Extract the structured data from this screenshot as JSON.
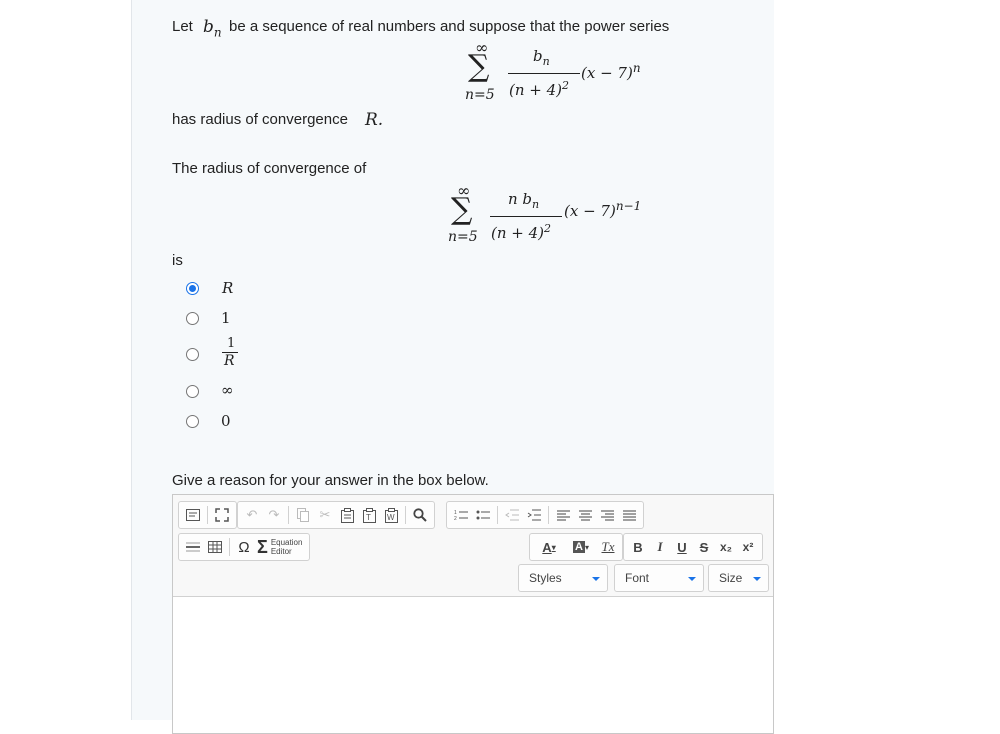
{
  "question": {
    "intro_before": "Let",
    "intro_var": "b",
    "intro_sub": "n",
    "intro_after": "be a sequence of real numbers and suppose that the power series",
    "series1": {
      "sum_lower": "n=5",
      "sum_upper": "∞",
      "numerator": "bn",
      "denominator": "(n + 4)2",
      "factor": "(x − 7)n"
    },
    "radius_text": "has radius of convergence",
    "radius_symbol": "R.",
    "second_intro": "The radius of convergence of",
    "series2": {
      "sum_lower": "n=5",
      "sum_upper": "∞",
      "numerator": "n bn",
      "denominator": "(n + 4)2",
      "factor": "(x − 7)n−1"
    },
    "is_label": "is"
  },
  "options": [
    {
      "label": "R",
      "selected": true
    },
    {
      "label": "1",
      "selected": false
    },
    {
      "label": "1/R",
      "numerator": "1",
      "denominator": "R",
      "selected": false
    },
    {
      "label": "∞",
      "selected": false
    },
    {
      "label": "0",
      "selected": false
    }
  ],
  "reason_prompt": "Give a reason for your answer in the box below.",
  "editor": {
    "toolbar_row1": {
      "source": "source-icon",
      "maximize": "maximize-icon",
      "undo": "↶",
      "redo": "↷",
      "copy": "copy-icon",
      "cut": "✂",
      "paste": "paste-icon",
      "paste_text": "paste-text-icon",
      "paste_word": "paste-word-icon",
      "find": "search-icon",
      "numbered_list": "numbered-list-icon",
      "bulleted_list": "bulleted-list-icon",
      "outdent": "outdent-icon",
      "indent": "indent-icon",
      "align_left": "align-left-icon",
      "align_center": "align-center-icon",
      "align_right": "align-right-icon",
      "justify": "justify-icon"
    },
    "toolbar_row2": {
      "horizontal_line": "horizontal-line-icon",
      "table": "table-icon",
      "special_char": "Ω",
      "sigma": "Σ",
      "equation_editor_line1": "Equation",
      "equation_editor_line2": "Editor",
      "text_color": "A",
      "bg_color": "A",
      "remove_format": "Tx",
      "bold": "B",
      "italic": "I",
      "underline": "U",
      "strike": "S",
      "subscript": "x₂",
      "superscript": "x²"
    },
    "styles_label": "Styles",
    "font_label": "Font",
    "size_label": "Size",
    "content": ""
  },
  "colors": {
    "accent": "#1a73e8",
    "panel_bg": "#f6f9fb"
  }
}
